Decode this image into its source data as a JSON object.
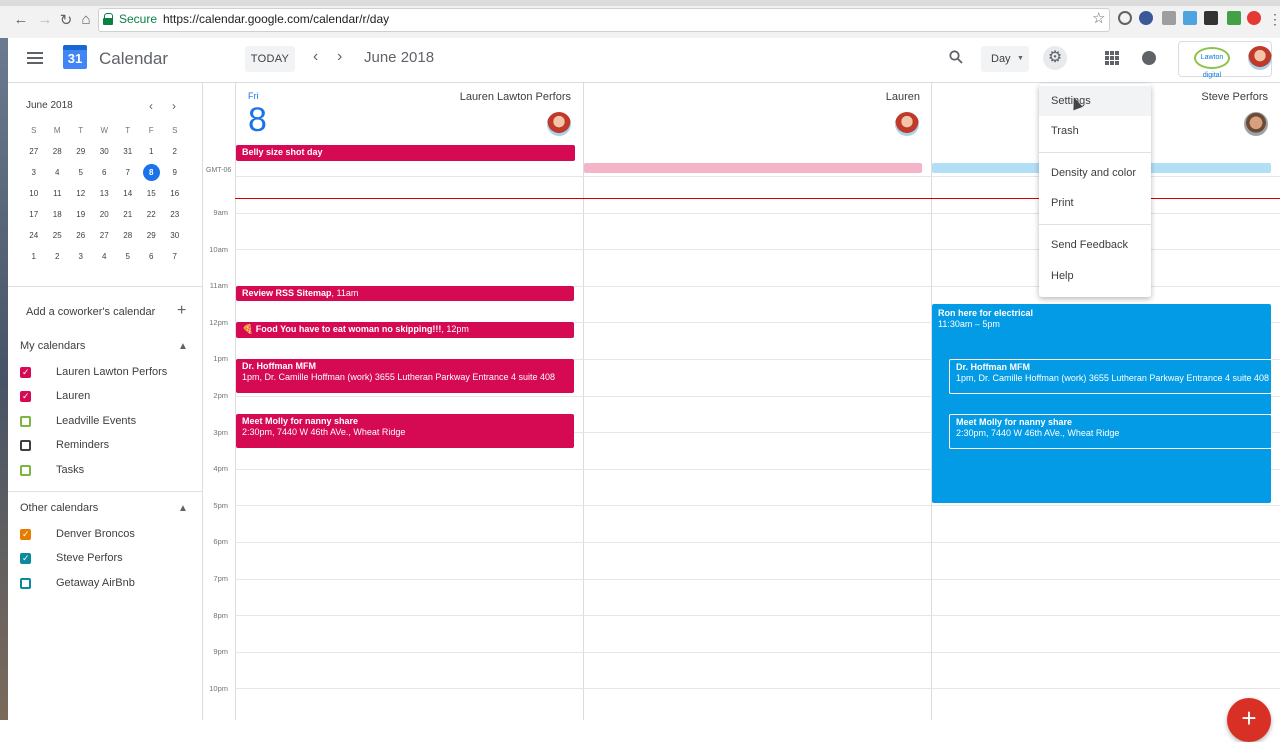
{
  "browser": {
    "secure_label": "Secure",
    "url": "https://calendar.google.com/calendar/r/day"
  },
  "header": {
    "app_name": "Calendar",
    "logo_day": "31",
    "today_label": "TODAY",
    "month_label": "June 2018",
    "view_label": "Day",
    "brand_text": "Lawton digital"
  },
  "mini_calendar": {
    "month": "June 2018",
    "weekday_headers": [
      "S",
      "M",
      "T",
      "W",
      "T",
      "F",
      "S"
    ],
    "weeks": [
      [
        "27",
        "28",
        "29",
        "30",
        "31",
        "1",
        "2"
      ],
      [
        "3",
        "4",
        "5",
        "6",
        "7",
        "8",
        "9"
      ],
      [
        "10",
        "11",
        "12",
        "13",
        "14",
        "15",
        "16"
      ],
      [
        "17",
        "18",
        "19",
        "20",
        "21",
        "22",
        "23"
      ],
      [
        "24",
        "25",
        "26",
        "27",
        "28",
        "29",
        "30"
      ],
      [
        "1",
        "2",
        "3",
        "4",
        "5",
        "6",
        "7"
      ]
    ],
    "selected": "8"
  },
  "sidebar": {
    "add_coworker": "Add a coworker's calendar",
    "my_calendars_title": "My calendars",
    "my_calendars": [
      {
        "name": "Lauren Lawton Perfors",
        "checked": true,
        "color": "#d50a53"
      },
      {
        "name": "Lauren",
        "checked": true,
        "color": "#d50a53"
      },
      {
        "name": "Leadville Events",
        "checked": false,
        "color": "#7cb342"
      },
      {
        "name": "Reminders",
        "checked": false,
        "color": "#3c4043"
      },
      {
        "name": "Tasks",
        "checked": false,
        "color": "#7cb342"
      }
    ],
    "other_calendars_title": "Other calendars",
    "other_calendars": [
      {
        "name": "Denver Broncos",
        "checked": true,
        "color": "#e67c00"
      },
      {
        "name": "Steve Perfors",
        "checked": true,
        "color": "#0b8a9e"
      },
      {
        "name": "Getaway AirBnb",
        "checked": false,
        "color": "#0b8a9e"
      }
    ]
  },
  "day": {
    "weekday": "Fri",
    "date": "8",
    "timezone": "GMT-06",
    "columns": [
      "Lauren Lawton Perfors",
      "Lauren",
      "Steve Perfors"
    ],
    "hours": [
      "9am",
      "10am",
      "11am",
      "12pm",
      "1pm",
      "2pm",
      "3pm",
      "4pm",
      "5pm",
      "6pm",
      "7pm",
      "8pm",
      "9pm",
      "10pm"
    ]
  },
  "events": {
    "allday1": "Belly size shot day",
    "rss": {
      "title": "Review RSS Sitemap",
      "time": ", 11am"
    },
    "food": {
      "title": "Food You have to eat woman no skipping!!!",
      "time": ", 12pm"
    },
    "hoffman": {
      "title": "Dr. Hoffman MFM",
      "detail": "1pm, Dr. Camille Hoffman (work) 3655 Lutheran Parkway Entrance 4 suite 408"
    },
    "molly": {
      "title": "Meet Molly for nanny share",
      "detail": "2:30pm, 7440 W 46th AVe., Wheat Ridge"
    },
    "ron": {
      "title": "Ron here for electrical",
      "time": "11:30am – 5pm"
    },
    "hoffman2": {
      "title": "Dr. Hoffman MFM",
      "detail": "1pm, Dr. Camille Hoffman (work) 3655 Lutheran Parkway Entrance 4 suite 408"
    },
    "molly2": {
      "title": "Meet Molly for nanny share",
      "detail": "2:30pm, 7440 W 46th AVe., Wheat Ridge"
    }
  },
  "settings_menu": {
    "items": [
      "Settings",
      "Trash",
      "Density and color",
      "Print",
      "Send Feedback",
      "Help"
    ]
  },
  "fab_label": "+",
  "colors": {
    "crimson": "#d50a53",
    "blue": "#039be5",
    "accent": "#1a73e8",
    "now_line": "#d50000"
  }
}
